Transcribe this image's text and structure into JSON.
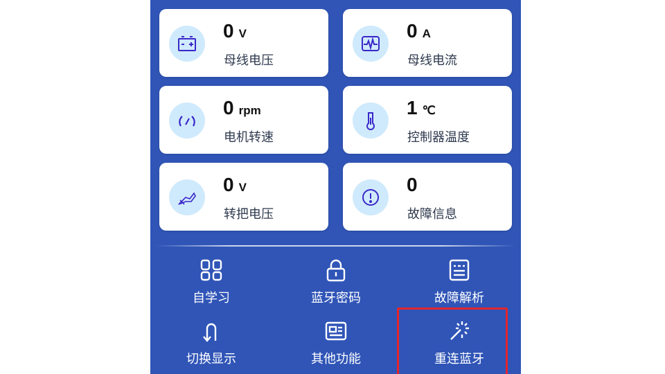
{
  "cards": [
    {
      "value": "0",
      "unit": "V",
      "label": "母线电压",
      "icon": "battery-icon"
    },
    {
      "value": "0",
      "unit": "A",
      "label": "母线电流",
      "icon": "waveform-icon"
    },
    {
      "value": "0",
      "unit": "rpm",
      "label": "电机转速",
      "icon": "speedometer-icon"
    },
    {
      "value": "1",
      "unit": "℃",
      "label": "控制器温度",
      "icon": "thermometer-icon"
    },
    {
      "value": "0",
      "unit": "V",
      "label": "转把电压",
      "icon": "throttle-icon"
    },
    {
      "value": "0",
      "unit": "",
      "label": "故障信息",
      "icon": "alert-icon"
    }
  ],
  "functions": [
    {
      "label": "自学习",
      "icon": "grid-icon"
    },
    {
      "label": "蓝牙密码",
      "icon": "lock-icon"
    },
    {
      "label": "故障解析",
      "icon": "list-panel-icon"
    },
    {
      "label": "切换显示",
      "icon": "u-turn-arrow-icon"
    },
    {
      "label": "其他功能",
      "icon": "id-card-icon"
    },
    {
      "label": "重连蓝牙",
      "icon": "magic-wand-icon"
    }
  ],
  "colors": {
    "background": "#3055b7",
    "card": "#ffffff",
    "icon_circle": "#cfeafc",
    "icon_stroke": "#3b27c9",
    "highlight": "#e3252c"
  }
}
